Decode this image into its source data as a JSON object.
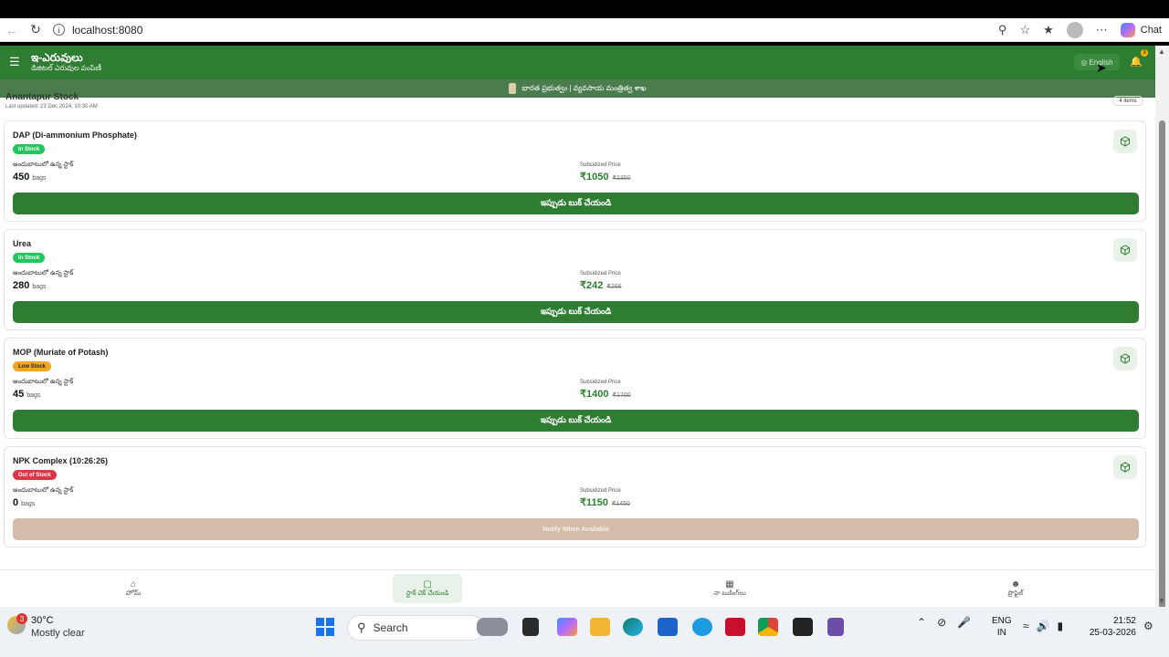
{
  "browser": {
    "url": "localhost:8080",
    "chat_label": "Chat"
  },
  "header": {
    "title": "ఇ-ఎరువులు",
    "subtitle": "డిజిటల్ ఎరువుల పంపిణీ",
    "lang_button": "English",
    "notification_count": "3",
    "ministry": "భారత ప్రభుత్వం | వ్యవసాయ మంత్రిత్వ శాఖ"
  },
  "stock": {
    "title": "Anantapur Stock",
    "updated": "Last updated: 23 Dec 2024, 10:30 AM",
    "count": "4 items"
  },
  "items": [
    {
      "name": "DAP (Di-ammonium Phosphate)",
      "status": "In Stock",
      "avail_label": "అందుబాటులో ఉన్న స్టాక్",
      "qty": "450",
      "unit": "bags",
      "price_label": "Subsidized Price",
      "price": "₹1050",
      "old_price": "₹1350",
      "button": "ఇప్పుడు బుక్ చేయండి"
    },
    {
      "name": "Urea",
      "status": "In Stock",
      "avail_label": "అందుబాటులో ఉన్న స్టాక్",
      "qty": "280",
      "unit": "bags",
      "price_label": "Subsidized Price",
      "price": "₹242",
      "old_price": "₹266",
      "button": "ఇప్పుడు బుక్ చేయండి"
    },
    {
      "name": "MOP (Muriate of Potash)",
      "status": "Low Stock",
      "avail_label": "అందుబాటులో ఉన్న స్టాక్",
      "qty": "45",
      "unit": "bags",
      "price_label": "Subsidized Price",
      "price": "₹1400",
      "old_price": "₹1700",
      "button": "ఇప్పుడు బుక్ చేయండి"
    },
    {
      "name": "NPK Complex (10:26:26)",
      "status": "Out of Stock",
      "avail_label": "అందుబాటులో ఉన్న స్టాక్",
      "qty": "0",
      "unit": "bags",
      "price_label": "Subsidized Price",
      "price": "₹1150",
      "old_price": "₹1450",
      "button": "Notify When Available"
    }
  ],
  "bottom_nav": [
    {
      "label": "హోమ్",
      "icon": "home-icon"
    },
    {
      "label": "స్టాక్ చెక్ చేయండి",
      "icon": "box-icon"
    },
    {
      "label": "నా బుకింగ్‌లు",
      "icon": "calendar-icon"
    },
    {
      "label": "ప్రొఫైల్",
      "icon": "user-icon"
    }
  ],
  "taskbar": {
    "weather_badge": "3",
    "temperature": "30°C",
    "weather": "Mostly clear",
    "search_placeholder": "Search",
    "lang_top": "ENG",
    "lang_bottom": "IN",
    "time": "21:52",
    "date": "25-03-2026"
  },
  "colors": {
    "primary": "#2e7d32",
    "in_stock": "#22c55e",
    "low_stock": "#f5a623",
    "out_of_stock": "#dc3545",
    "disabled_button": "#d4bca8"
  }
}
